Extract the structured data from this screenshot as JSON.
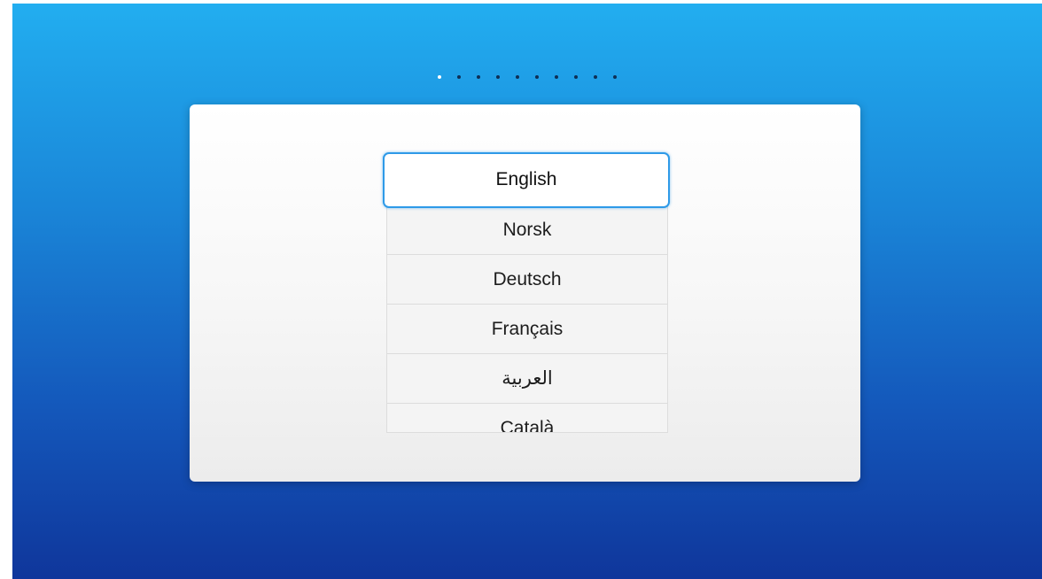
{
  "setup": {
    "page_indicator": {
      "total": 10,
      "current": 1
    },
    "language_list": {
      "selected": "English",
      "items": [
        {
          "label": "English"
        },
        {
          "label": "Norsk"
        },
        {
          "label": "Deutsch"
        },
        {
          "label": "Français"
        },
        {
          "label": "العربية"
        },
        {
          "label": "Català"
        }
      ]
    }
  }
}
